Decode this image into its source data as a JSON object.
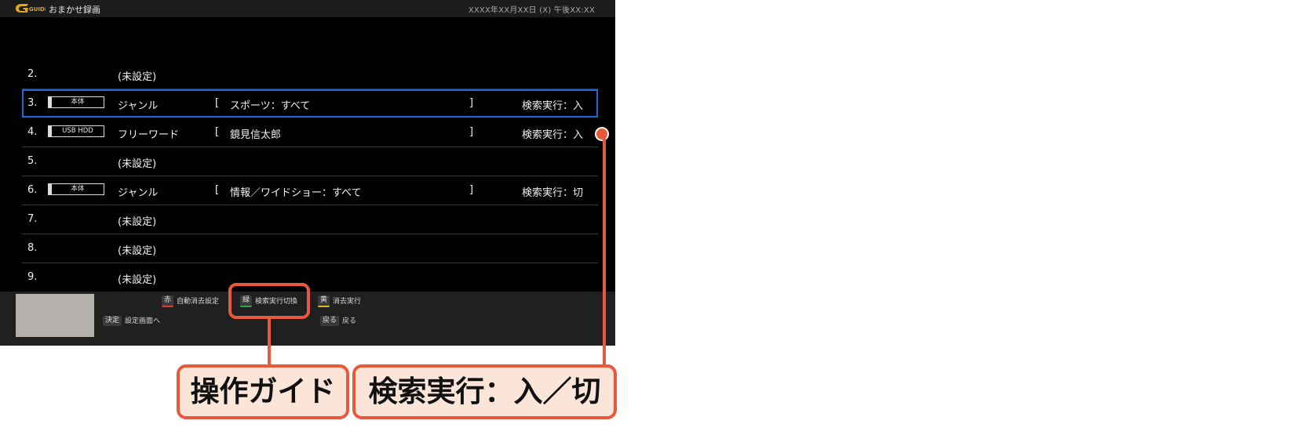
{
  "topbar": {
    "logo_text": "G-GUIDE",
    "title": "おまかせ録画",
    "datetime": "XXXX年XX月XX日 (X)  午後XX:XX"
  },
  "rows": [
    {
      "num": "2.",
      "device": "",
      "type": "(未設定)",
      "lbracket": "",
      "keyword": "",
      "rbracket": "",
      "exec": ""
    },
    {
      "num": "3.",
      "device": "本体",
      "type": "ジャンル",
      "lbracket": "[",
      "keyword": "スポーツ：すべて",
      "rbracket": "]",
      "exec": "検索実行：入"
    },
    {
      "num": "4.",
      "device": "USB HDD",
      "type": "フリーワード",
      "lbracket": "[",
      "keyword": "鏡見信太郎",
      "rbracket": "]",
      "exec": "検索実行：入"
    },
    {
      "num": "5.",
      "device": "",
      "type": "(未設定)",
      "lbracket": "",
      "keyword": "",
      "rbracket": "",
      "exec": ""
    },
    {
      "num": "6.",
      "device": "本体",
      "type": "ジャンル",
      "lbracket": "[",
      "keyword": "情報／ワイドショー：すべて",
      "rbracket": "]",
      "exec": "検索実行：切"
    },
    {
      "num": "7.",
      "device": "",
      "type": "(未設定)",
      "lbracket": "",
      "keyword": "",
      "rbracket": "",
      "exec": ""
    },
    {
      "num": "8.",
      "device": "",
      "type": "(未設定)",
      "lbracket": "",
      "keyword": "",
      "rbracket": "",
      "exec": ""
    },
    {
      "num": "9.",
      "device": "",
      "type": "(未設定)",
      "lbracket": "",
      "keyword": "",
      "rbracket": "",
      "exec": ""
    }
  ],
  "guide": {
    "red_key": "赤",
    "red_label": "自動消去設定",
    "green_key": "緑",
    "green_label": "検索実行切換",
    "yellow_key": "黄",
    "yellow_label": "消去実行",
    "enter_key": "決定",
    "enter_label": "設定画面へ",
    "back_key": "戻る",
    "back_label": "戻る"
  },
  "callouts": {
    "guide_label": "操作ガイド",
    "exec_label": "検索実行：入／切"
  },
  "colors": {
    "accent_callout": "#e8593c",
    "selection": "#1e6bd6"
  }
}
